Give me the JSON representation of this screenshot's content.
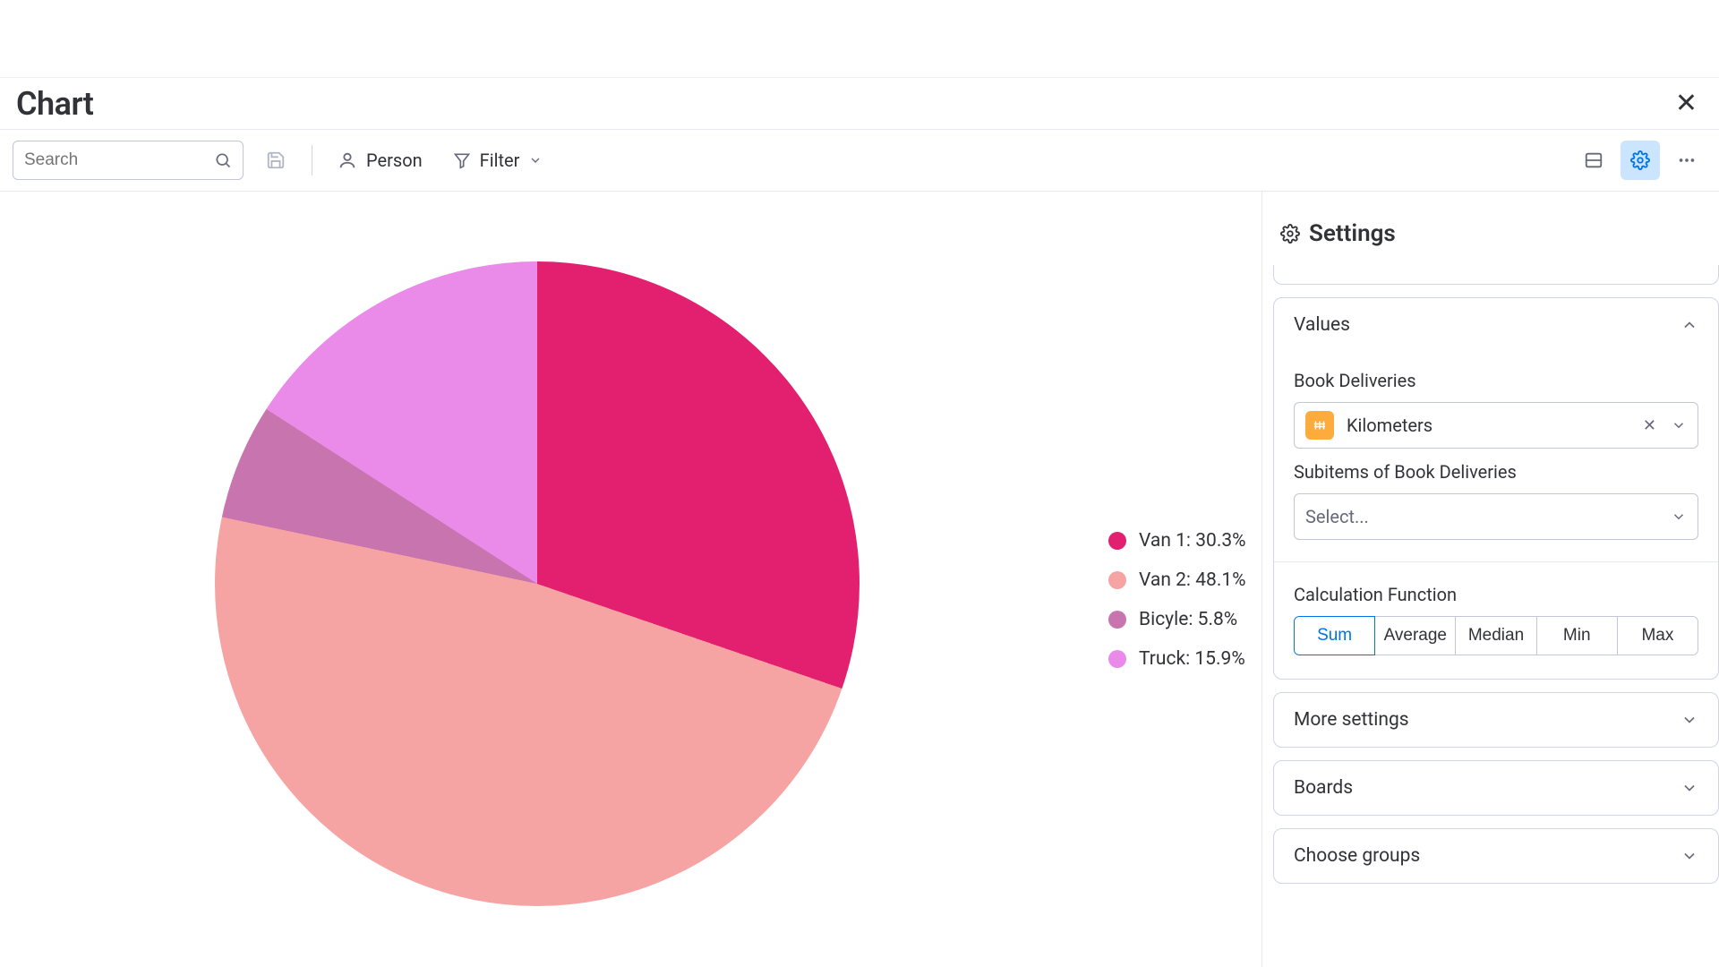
{
  "header": {
    "title": "Chart"
  },
  "toolbar": {
    "search_placeholder": "Search",
    "person_label": "Person",
    "filter_label": "Filter"
  },
  "settings": {
    "title": "Settings",
    "sections": {
      "values": {
        "title": "Values",
        "group_a_label": "Book Deliveries",
        "column_selected": "Kilometers",
        "group_b_label": "Subitems of Book Deliveries",
        "subitems_placeholder": "Select...",
        "calc_label": "Calculation Function",
        "calc_options": [
          "Sum",
          "Average",
          "Median",
          "Min",
          "Max"
        ],
        "calc_active": "Sum"
      },
      "more": {
        "title": "More settings"
      },
      "boards": {
        "title": "Boards"
      },
      "groups": {
        "title": "Choose groups"
      }
    }
  },
  "chart_data": {
    "type": "pie",
    "title": "",
    "series": [
      {
        "name": "Van 1",
        "value": 30.3,
        "color": "#e2206f"
      },
      {
        "name": "Van 2",
        "value": 48.1,
        "color": "#f5a3a3"
      },
      {
        "name": "Bicyle",
        "value": 5.8,
        "color": "#c774af"
      },
      {
        "name": "Truck",
        "value": 15.9,
        "color": "#ea8bea"
      }
    ],
    "legend_suffix": "%"
  }
}
